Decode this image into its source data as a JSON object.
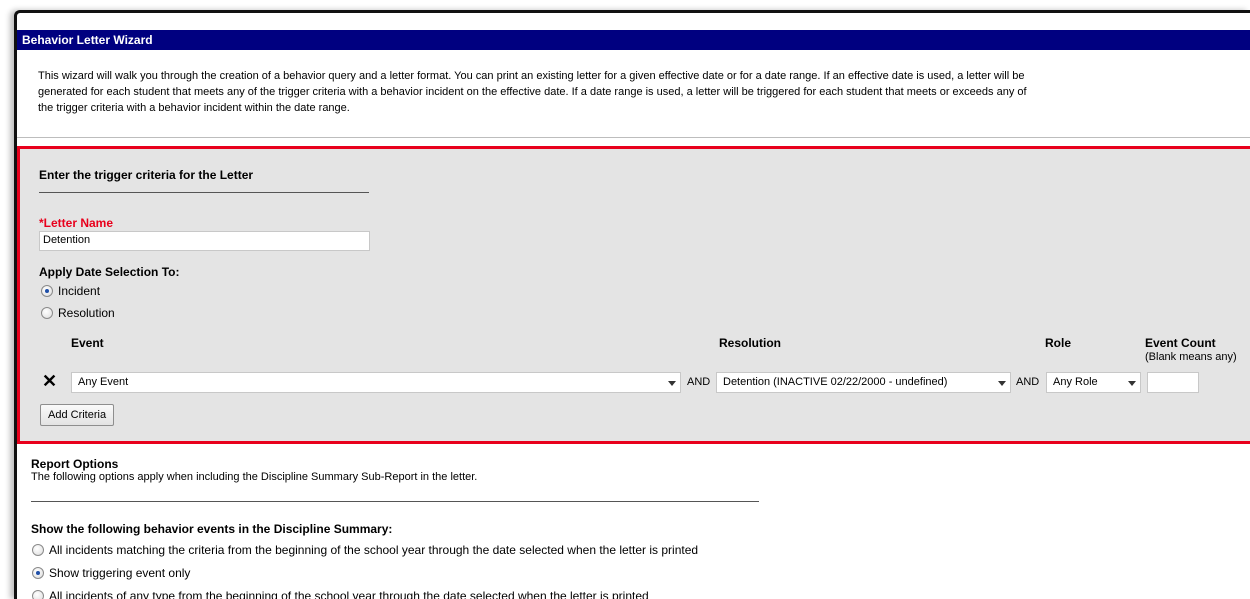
{
  "wizard": {
    "title": "Behavior Letter Wizard",
    "intro_lines": [
      "This wizard will walk you through the creation of a behavior query and a letter format. You can print an existing letter for a given effective date or for a date range. If an effective date is used, a letter will be",
      "generated for each student that meets any of the trigger criteria with a behavior incident on the effective date. If a date range is used, a letter will be triggered for each student that meets or exceeds any of",
      "the trigger criteria with a behavior incident within the date range."
    ]
  },
  "criteria": {
    "heading": "Enter the trigger criteria for the Letter",
    "letter_name_label": "*Letter Name",
    "letter_name_value": "Detention",
    "apply_date_label": "Apply Date Selection To:",
    "apply_options": [
      {
        "label": "Incident",
        "checked": true
      },
      {
        "label": "Resolution",
        "checked": false
      }
    ],
    "columns": {
      "event": "Event",
      "resolution": "Resolution",
      "role": "Role",
      "event_count": "Event Count",
      "event_count_note": "(Blank means any)"
    },
    "row": {
      "event": "Any Event",
      "and1": "AND",
      "resolution": "Detention (INACTIVE 02/22/2000 - undefined)",
      "and2": "AND",
      "role": "Any Role",
      "count": ""
    },
    "add_button": "Add Criteria"
  },
  "report_options": {
    "title": "Report Options",
    "description": "The following options apply when including the Discipline Summary Sub-Report in the letter.",
    "show_heading": "Show the following behavior events in the Discipline Summary:",
    "options": [
      {
        "label": "All incidents matching the criteria from the beginning of the school year through the date selected when the letter is printed",
        "checked": false
      },
      {
        "label": "Show triggering event only",
        "checked": true
      },
      {
        "label": "All incidents of any type from the beginning of the school year through the date selected when the letter is printed",
        "checked": false
      }
    ]
  }
}
